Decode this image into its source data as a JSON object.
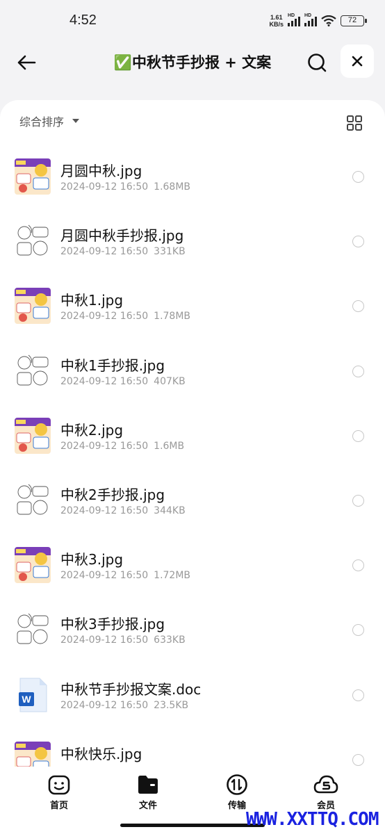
{
  "status": {
    "time": "4:52",
    "net_speed_value": "1.61",
    "net_speed_unit": "KB/s",
    "hd_label": "HD",
    "battery": "72"
  },
  "header": {
    "title": "✅中秋节手抄报 + 文案"
  },
  "toolbar": {
    "sort_label": "综合排序"
  },
  "files": [
    {
      "name": "月圆中秋.jpg",
      "date": "2024-09-12 16:50",
      "size": "1.68MB",
      "thumb": "color-poster"
    },
    {
      "name": "月圆中秋手抄报.jpg",
      "date": "2024-09-12 16:50",
      "size": "331KB",
      "thumb": "line-art"
    },
    {
      "name": "中秋1.jpg",
      "date": "2024-09-12 16:50",
      "size": "1.78MB",
      "thumb": "color-poster"
    },
    {
      "name": "中秋1手抄报.jpg",
      "date": "2024-09-12 16:50",
      "size": "407KB",
      "thumb": "line-art"
    },
    {
      "name": "中秋2.jpg",
      "date": "2024-09-12 16:50",
      "size": "1.6MB",
      "thumb": "color-poster"
    },
    {
      "name": "中秋2手抄报.jpg",
      "date": "2024-09-12 16:50",
      "size": "344KB",
      "thumb": "line-art"
    },
    {
      "name": "中秋3.jpg",
      "date": "2024-09-12 16:50",
      "size": "1.72MB",
      "thumb": "color-poster"
    },
    {
      "name": "中秋3手抄报.jpg",
      "date": "2024-09-12 16:50",
      "size": "633KB",
      "thumb": "line-art"
    },
    {
      "name": "中秋节手抄报文案.doc",
      "date": "2024-09-12 16:50",
      "size": "23.5KB",
      "thumb": "word-doc"
    },
    {
      "name": "中秋快乐.jpg",
      "date": "",
      "size": "",
      "thumb": "color-poster"
    }
  ],
  "tabs": [
    {
      "label": "首页",
      "icon": "smile-icon"
    },
    {
      "label": "文件",
      "icon": "folder-icon"
    },
    {
      "label": "传输",
      "icon": "transfer-icon"
    },
    {
      "label": "会员",
      "icon": "vip-cloud-icon"
    }
  ],
  "watermark": "WWW.XXTTQ.COM",
  "colors": {
    "watermark": "#1a22e0",
    "word_blue": "#1f5fbf",
    "page_bg": "#f3f3f5"
  }
}
